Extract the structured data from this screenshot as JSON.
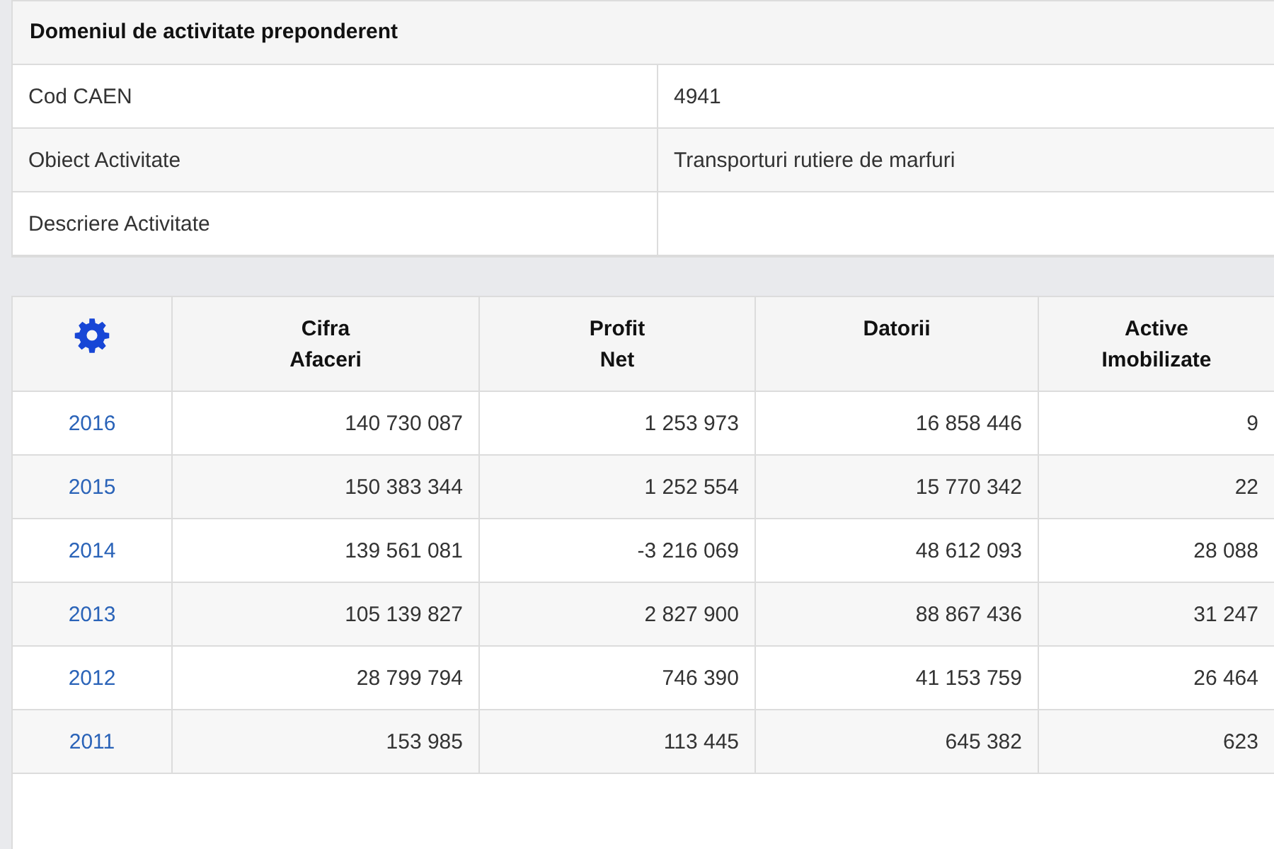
{
  "activity": {
    "title": "Domeniul de activitate preponderent",
    "rows": [
      {
        "label": "Cod CAEN",
        "value": "4941"
      },
      {
        "label": "Obiect Activitate",
        "value": "Transporturi rutiere de marfuri"
      },
      {
        "label": "Descriere Activitate"
      }
    ]
  },
  "financials": {
    "columns": [
      [
        "Cifra",
        "Afaceri"
      ],
      [
        "Profit",
        "Net"
      ],
      [
        "Datorii"
      ],
      [
        "Active",
        "Imobilizate"
      ]
    ],
    "rows": [
      {
        "year": "2016",
        "values": [
          "140 730 087",
          "1 253 973",
          "16 858 446",
          "9"
        ]
      },
      {
        "year": "2015",
        "values": [
          "150 383 344",
          "1 252 554",
          "15 770 342",
          "22"
        ]
      },
      {
        "year": "2014",
        "values": [
          "139 561 081",
          "-3 216 069",
          "48 612 093",
          "28 088"
        ]
      },
      {
        "year": "2013",
        "values": [
          "105 139 827",
          "2 827 900",
          "88 867 436",
          "31 247"
        ]
      },
      {
        "year": "2012",
        "values": [
          "28 799 794",
          "746 390",
          "41 153 759",
          "26 464"
        ]
      },
      {
        "year": "2011",
        "values": [
          "153 985",
          "113 445",
          "645 382",
          "623"
        ]
      }
    ]
  }
}
